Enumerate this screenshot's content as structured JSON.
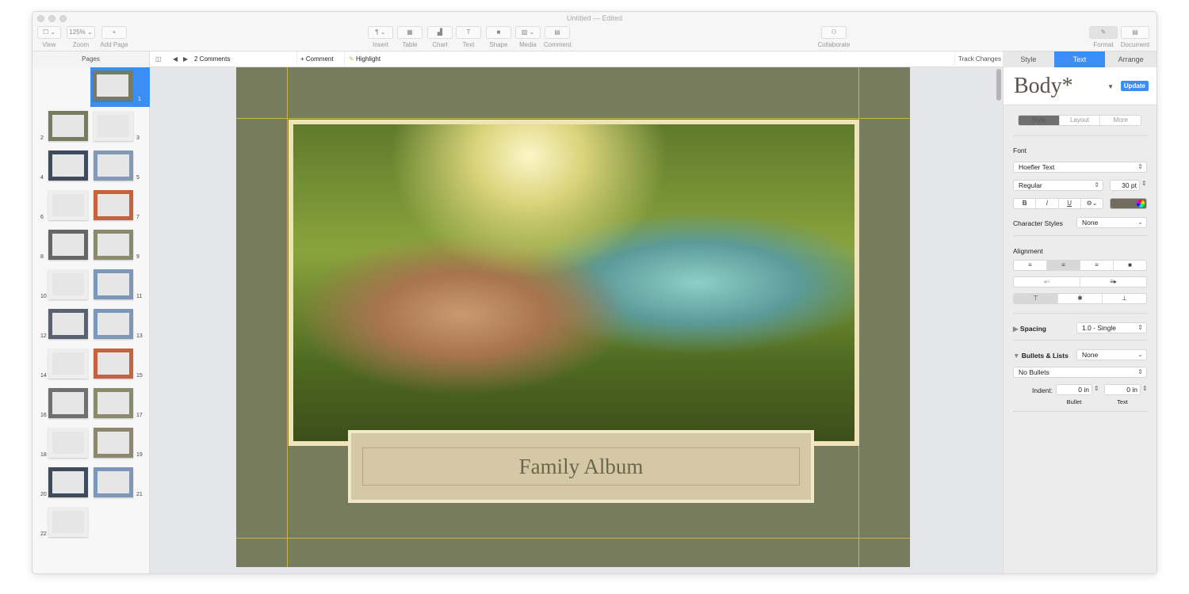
{
  "window": {
    "title": "Untitled — Edited"
  },
  "toolbar": {
    "left": [
      {
        "label": "View",
        "icon": "view-icon",
        "btn": "☐ ⌄"
      },
      {
        "label": "Zoom",
        "btn": "125% ⌄"
      },
      {
        "label": "Add Page",
        "icon": "plus-icon",
        "btn": "+"
      }
    ],
    "center": [
      {
        "label": "Insert",
        "icon": "paragraph-icon",
        "btn": "¶ ⌄"
      },
      {
        "label": "Table",
        "icon": "table-icon",
        "btn": "▦"
      },
      {
        "label": "Chart",
        "icon": "chart-icon",
        "btn": "▟"
      },
      {
        "label": "Text",
        "icon": "text-icon",
        "btn": "T"
      },
      {
        "label": "Shape",
        "icon": "shape-icon",
        "btn": "■"
      },
      {
        "label": "Media",
        "icon": "media-icon",
        "btn": "▨ ⌄"
      },
      {
        "label": "Comment",
        "icon": "comment-icon",
        "btn": "▤"
      }
    ],
    "collaborate": {
      "label": "Collaborate",
      "btn": "⚇"
    },
    "right": [
      {
        "label": "Format",
        "icon": "paintbrush-icon",
        "btn": "✎"
      },
      {
        "label": "Document",
        "icon": "document-icon",
        "btn": "▤"
      }
    ]
  },
  "subbar": {
    "pages": "Pages",
    "comments": "2 Comments",
    "add_comment": "+ Comment",
    "highlight": "Highlight",
    "track_changes": "Track Changes"
  },
  "inspector_tabs": [
    "Style",
    "Text",
    "Arrange"
  ],
  "active_inspector_tab": "Text",
  "thumbnails": [
    {
      "n": "1",
      "color": "#777c5f",
      "selected": true
    },
    {
      "n": "2",
      "color": "#777c5f"
    },
    {
      "n": "3",
      "color": "#eeeeee"
    },
    {
      "n": "4",
      "color": "#3f4a5c"
    },
    {
      "n": "5",
      "color": "#8499b5"
    },
    {
      "n": "6",
      "color": "#eeeeee"
    },
    {
      "n": "7",
      "color": "#c2643e"
    },
    {
      "n": "8",
      "color": "#666666"
    },
    {
      "n": "9",
      "color": "#8a8a6c"
    },
    {
      "n": "10",
      "color": "#eeeeee"
    },
    {
      "n": "11",
      "color": "#7d97b8"
    },
    {
      "n": "12",
      "color": "#5a6272"
    },
    {
      "n": "13",
      "color": "#7d97b8"
    },
    {
      "n": "14",
      "color": "#eeeeee"
    },
    {
      "n": "15",
      "color": "#c2643e"
    },
    {
      "n": "16",
      "color": "#707070"
    },
    {
      "n": "17",
      "color": "#8a8a6c"
    },
    {
      "n": "18",
      "color": "#eeeeee"
    },
    {
      "n": "19",
      "color": "#8e8770"
    },
    {
      "n": "20",
      "color": "#3f4a5c"
    },
    {
      "n": "21",
      "color": "#7d97b8"
    },
    {
      "n": "22",
      "color": "#eeeeee"
    }
  ],
  "document": {
    "caption": "Family Album",
    "page_color": "#777c5f",
    "guide_color": "#c9b545"
  },
  "inspector": {
    "paragraph_style": "Body*",
    "update": "Update",
    "subtabs": [
      "Style",
      "Layout",
      "More"
    ],
    "font_label": "Font",
    "font_family": "Hoefler Text",
    "font_typeface": "Regular",
    "font_size": "30 pt",
    "format_buttons": [
      "B",
      "I",
      "U",
      "⚙⌄"
    ],
    "text_color": "#716c5e",
    "character_styles_label": "Character Styles",
    "character_styles": "None",
    "alignment_label": "Alignment",
    "alignment": [
      "left",
      "center",
      "right",
      "justify"
    ],
    "active_alignment": "center",
    "indent_buttons": [
      "decrease-indent",
      "increase-indent"
    ],
    "vertical_alignment": [
      "top",
      "middle",
      "bottom"
    ],
    "active_vertical": "top",
    "spacing_label": "Spacing",
    "spacing": "1.0 - Single",
    "bullets_label": "Bullets & Lists",
    "bullets": "None",
    "bullet_type": "No Bullets",
    "indent_label": "Indent:",
    "bullet_indent": "0 in",
    "text_indent": "0 in",
    "bullet_caption": "Bullet",
    "text_caption": "Text"
  }
}
